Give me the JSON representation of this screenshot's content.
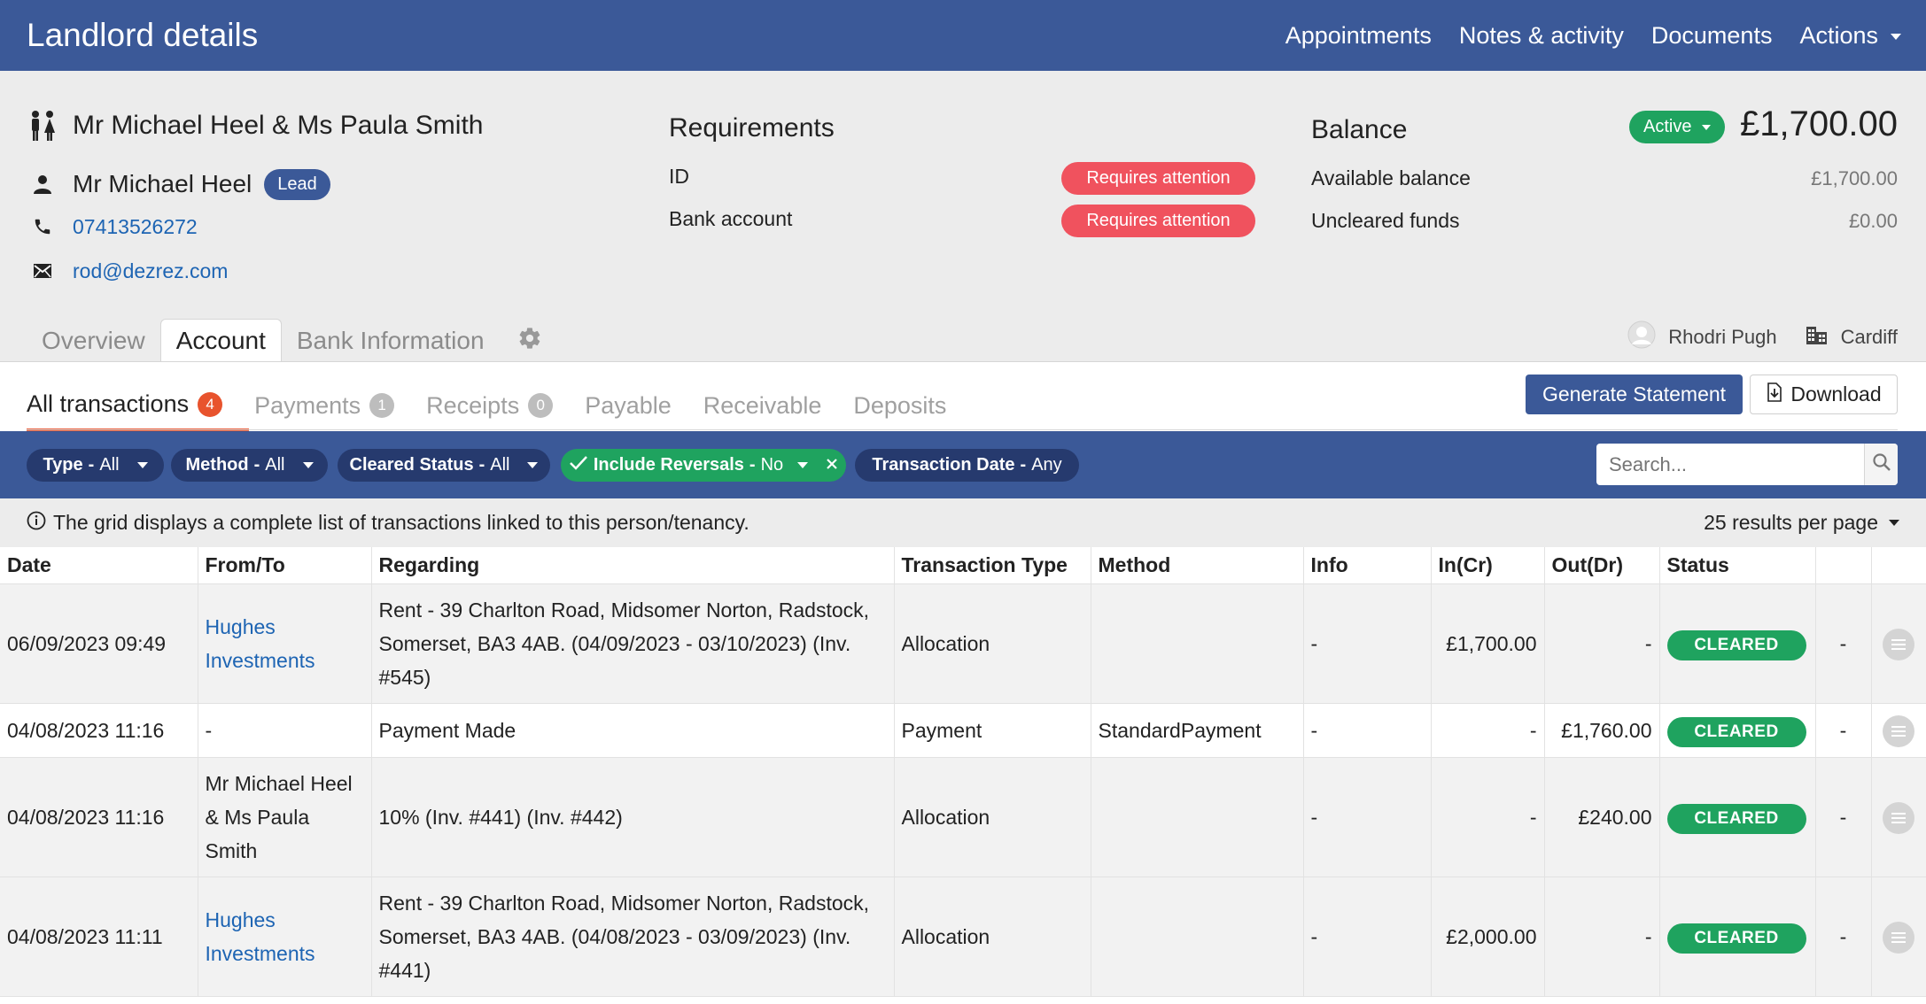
{
  "header": {
    "title": "Landlord details",
    "nav": [
      "Appointments",
      "Notes & activity",
      "Documents",
      "Actions"
    ]
  },
  "contact": {
    "name": "Mr Michael Heel & Ms Paula Smith",
    "lead_name": "Mr Michael Heel",
    "lead_badge": "Lead",
    "phone": "07413526272",
    "email": "rod@dezrez.com"
  },
  "requirements": {
    "title": "Requirements",
    "items": [
      {
        "label": "ID",
        "status": "Requires attention"
      },
      {
        "label": "Bank account",
        "status": "Requires attention"
      }
    ]
  },
  "balance": {
    "title": "Balance",
    "status": "Active",
    "total": "£1,700.00",
    "available_label": "Available balance",
    "available_value": "£1,700.00",
    "uncleared_label": "Uncleared funds",
    "uncleared_value": "£0.00"
  },
  "main_tabs": [
    "Overview",
    "Account",
    "Bank Information"
  ],
  "owner": {
    "negotiator": "Rhodri Pugh",
    "branch": "Cardiff"
  },
  "sub_tabs": [
    {
      "label": "All transactions",
      "count": "4"
    },
    {
      "label": "Payments",
      "count": "1"
    },
    {
      "label": "Receipts",
      "count": "0"
    },
    {
      "label": "Payable"
    },
    {
      "label": "Receivable"
    },
    {
      "label": "Deposits"
    }
  ],
  "actions": {
    "generate": "Generate Statement",
    "download": "Download"
  },
  "filters": [
    {
      "key": "Type",
      "value": "All"
    },
    {
      "key": "Method",
      "value": "All"
    },
    {
      "key": "Cleared Status",
      "value": "All"
    },
    {
      "key": "Include Reversals",
      "value": "No"
    },
    {
      "key": "Transaction Date",
      "value": "Any"
    }
  ],
  "search": {
    "placeholder": "Search..."
  },
  "info": {
    "message": "The grid displays a complete list of transactions linked to this person/tenancy.",
    "per_page": "25 results per page"
  },
  "table": {
    "columns": [
      "Date",
      "From/To",
      "Regarding",
      "Transaction Type",
      "Method",
      "Info",
      "In(Cr)",
      "Out(Dr)",
      "Status",
      ""
    ],
    "rows": [
      {
        "date": "06/09/2023 09:49",
        "from_to": "Hughes Investments",
        "regarding": "Rent - 39 Charlton Road, Midsomer Norton, Radstock, Somerset, BA3 4AB. (04/09/2023 - 03/10/2023) (Inv. #545)",
        "type": "Allocation",
        "method": "",
        "info": "-",
        "in": "£1,700.00",
        "out": "-",
        "status": "CLEARED",
        "extra": "-"
      },
      {
        "date": "04/08/2023 11:16",
        "from_to": "-",
        "regarding": "Payment Made",
        "type": "Payment",
        "method": "StandardPayment",
        "info": "-",
        "in": "-",
        "out": "£1,760.00",
        "status": "CLEARED",
        "extra": "-"
      },
      {
        "date": "04/08/2023 11:16",
        "from_to": "Mr Michael Heel & Ms Paula Smith",
        "regarding": "10% (Inv. #441) (Inv. #442)",
        "type": "Allocation",
        "method": "",
        "info": "-",
        "in": "-",
        "out": "£240.00",
        "status": "CLEARED",
        "extra": "-"
      },
      {
        "date": "04/08/2023 11:11",
        "from_to": "Hughes Investments",
        "regarding": "Rent - 39 Charlton Road, Midsomer Norton, Radstock, Somerset, BA3 4AB. (04/08/2023 - 03/09/2023) (Inv. #441)",
        "type": "Allocation",
        "method": "",
        "info": "-",
        "in": "£2,000.00",
        "out": "-",
        "status": "CLEARED",
        "extra": "-"
      }
    ]
  },
  "colors": {
    "brand": "#3b5998",
    "success": "#1fa35f",
    "danger": "#f0525e",
    "accent": "#e8532d",
    "link": "#1d64b3"
  }
}
